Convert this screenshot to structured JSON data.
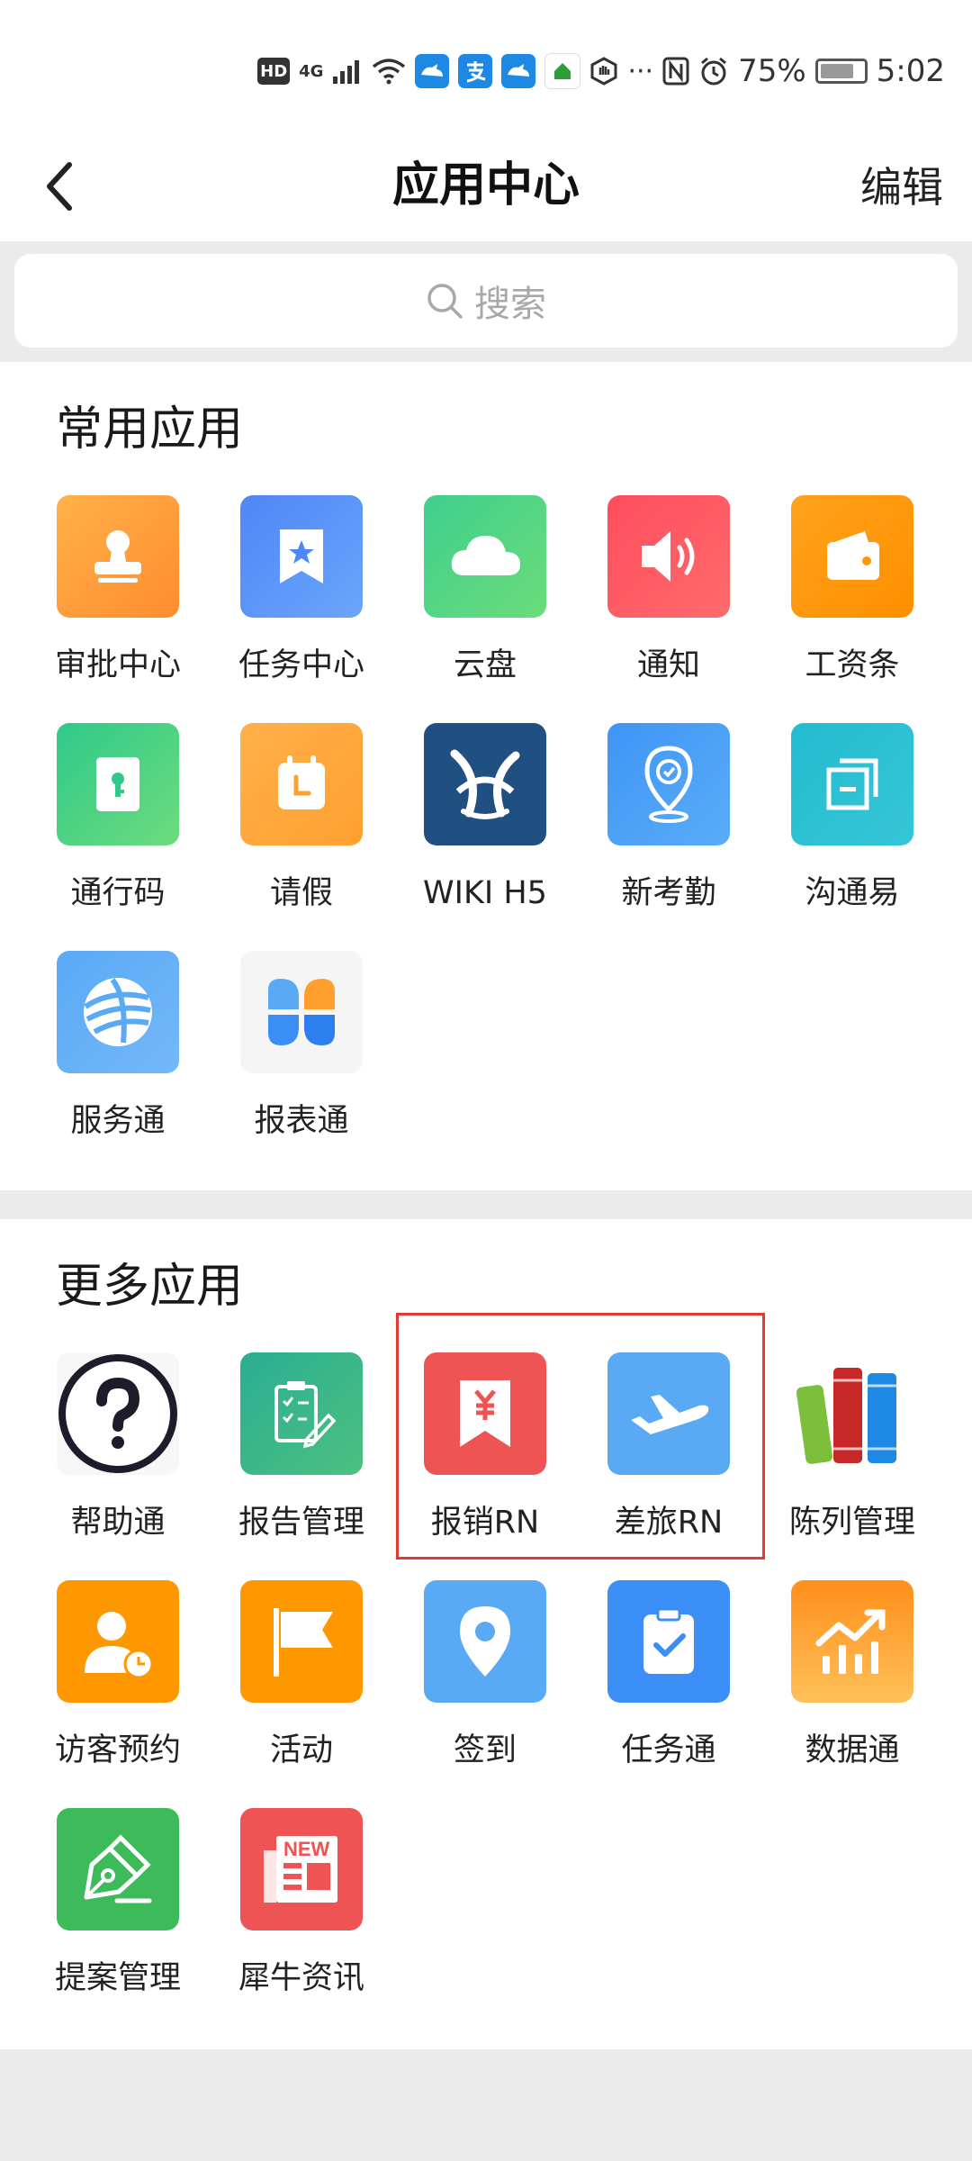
{
  "status_bar": {
    "network": "4G",
    "battery": "75%",
    "time": "5:02"
  },
  "navbar": {
    "title": "应用中心",
    "edit_label": "编辑"
  },
  "search": {
    "placeholder": "搜索"
  },
  "common_apps": {
    "title": "常用应用",
    "items": [
      {
        "label": "审批中心",
        "icon": "stamp-icon",
        "color": "#ff9f43"
      },
      {
        "label": "任务中心",
        "icon": "bookmark-star-icon",
        "color": "#4a8cf7"
      },
      {
        "label": "云盘",
        "icon": "cloud-icon",
        "color": "#4cd17e"
      },
      {
        "label": "通知",
        "icon": "speaker-icon",
        "color": "#f7465a"
      },
      {
        "label": "工资条",
        "icon": "wallet-icon",
        "color": "#ff9800"
      },
      {
        "label": "通行码",
        "icon": "key-card-icon",
        "color": "#3dcf7d"
      },
      {
        "label": "请假",
        "icon": "calendar-icon",
        "color": "#ffa93a"
      },
      {
        "label": "WIKI H5",
        "icon": "confluence-logo-icon",
        "color": "#205081"
      },
      {
        "label": "新考勤",
        "icon": "location-check-icon",
        "color": "#4a9ff5"
      },
      {
        "label": "沟通易",
        "icon": "window-stack-icon",
        "color": "#2bbfcf"
      },
      {
        "label": "服务通",
        "icon": "swirl-logo-icon",
        "color": "#5aa9f5"
      },
      {
        "label": "报表通",
        "icon": "four-leaf-icon",
        "color": "#f5f5f5"
      }
    ]
  },
  "more_apps": {
    "title": "更多应用",
    "items": [
      {
        "label": "帮助通",
        "icon": "question-icon",
        "color": "#ffffff"
      },
      {
        "label": "报告管理",
        "icon": "report-clipboard-icon",
        "color": "#3cb38a"
      },
      {
        "label": "报销RN",
        "icon": "yen-bookmark-icon",
        "color": "#ee5454"
      },
      {
        "label": "差旅RN",
        "icon": "airplane-icon",
        "color": "#5aa9f5"
      },
      {
        "label": "陈列管理",
        "icon": "books-icon",
        "color": "#ffffff"
      },
      {
        "label": "访客预约",
        "icon": "visitor-clock-icon",
        "color": "#ff9800"
      },
      {
        "label": "活动",
        "icon": "flag-icon",
        "color": "#ff9800"
      },
      {
        "label": "签到",
        "icon": "map-pin-icon",
        "color": "#5aa9f5"
      },
      {
        "label": "任务通",
        "icon": "clipboard-check-icon",
        "color": "#3b8ef5"
      },
      {
        "label": "数据通",
        "icon": "chart-trend-icon",
        "color": "#ffa133"
      },
      {
        "label": "提案管理",
        "icon": "pen-nib-icon",
        "color": "#3dbb5b"
      },
      {
        "label": "犀牛资讯",
        "icon": "news-icon",
        "color": "#ee5454"
      }
    ]
  }
}
